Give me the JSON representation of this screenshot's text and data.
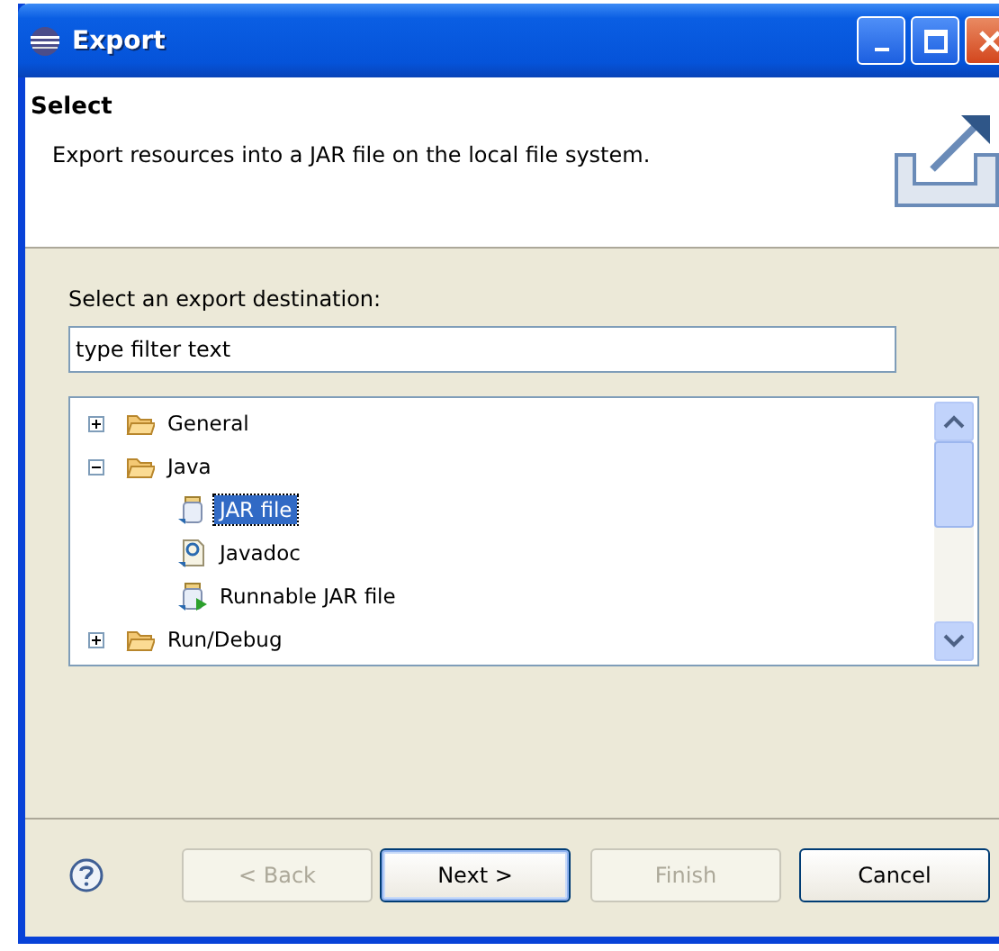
{
  "window": {
    "title": "Export"
  },
  "header": {
    "title": "Select",
    "description": "Export resources into a JAR file on the local file system."
  },
  "filter": {
    "label": "Select an export destination:",
    "value": "type filter text"
  },
  "tree": [
    {
      "label": "General",
      "kind": "folder",
      "expanded": false,
      "selected": false
    },
    {
      "label": "Java",
      "kind": "folder",
      "expanded": true,
      "selected": false,
      "children": [
        {
          "label": "JAR file",
          "kind": "jar",
          "selected": true
        },
        {
          "label": "Javadoc",
          "kind": "javadoc",
          "selected": false
        },
        {
          "label": "Runnable JAR file",
          "kind": "runnable-jar",
          "selected": false
        }
      ]
    },
    {
      "label": "Run/Debug",
      "kind": "folder",
      "expanded": false,
      "selected": false
    }
  ],
  "buttons": [
    {
      "label": "< Back",
      "disabled": true,
      "default": false
    },
    {
      "label": "Next >",
      "disabled": false,
      "default": true
    },
    {
      "label": "Finish",
      "disabled": true,
      "default": false
    },
    {
      "label": "Cancel",
      "disabled": false,
      "default": false
    }
  ]
}
